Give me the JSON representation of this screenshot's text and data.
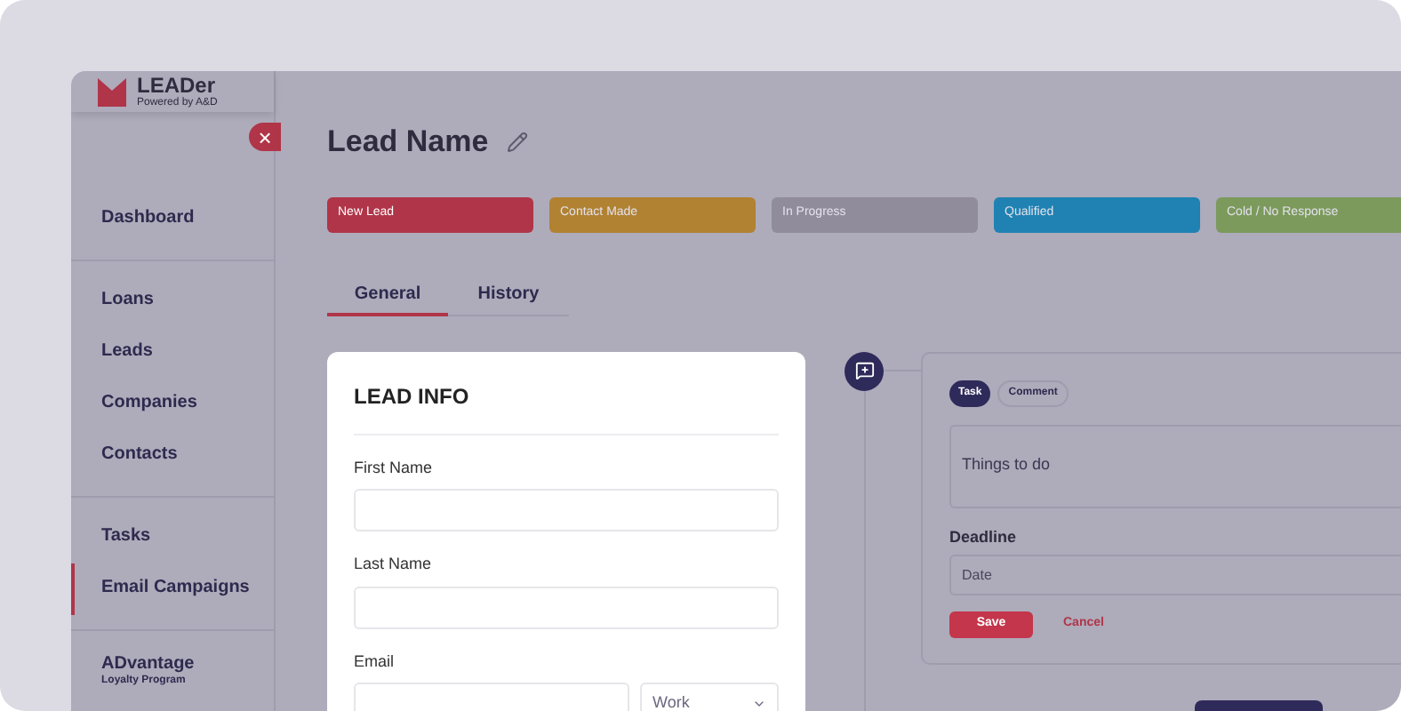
{
  "logo": {
    "name": "LEADer",
    "tagline": "Powered by A&D"
  },
  "sidebar": {
    "sections": [
      [
        {
          "label": "Dashboard",
          "selected": false
        }
      ],
      [
        {
          "label": "Loans",
          "selected": false
        },
        {
          "label": "Leads",
          "selected": false
        },
        {
          "label": "Companies",
          "selected": false
        },
        {
          "label": "Contacts",
          "selected": false
        }
      ],
      [
        {
          "label": "Tasks",
          "selected": false
        },
        {
          "label": "Email Campaigns",
          "selected": true
        }
      ],
      [
        {
          "label": "ADvantage",
          "subtitle": "Loyalty Program",
          "selected": false
        }
      ]
    ]
  },
  "close_button": {
    "symbol": "×"
  },
  "page": {
    "title": "Lead Name"
  },
  "statuses": [
    {
      "label": "New Lead",
      "color": "#b03548",
      "selected": true
    },
    {
      "label": "Contact Made",
      "color": "#b08232",
      "selected": false
    },
    {
      "label": "In Progress",
      "color": "#908c9c",
      "selected": false
    },
    {
      "label": "Qualified",
      "color": "#1f82b2",
      "selected": false
    },
    {
      "label": "Cold / No Response",
      "color": "#7b9a5c",
      "selected": false
    }
  ],
  "tabs": [
    {
      "label": "General",
      "selected": true
    },
    {
      "label": "History",
      "selected": false
    }
  ],
  "lead_info": {
    "title": "LEAD INFO",
    "fields": [
      {
        "label": "First Name",
        "kind": "text"
      },
      {
        "label": "Last Name",
        "kind": "text"
      },
      {
        "label": "Email",
        "kind": "email",
        "type_value": "Work"
      }
    ]
  },
  "activity": {
    "types": [
      {
        "label": "Task",
        "selected": true
      },
      {
        "label": "Comment",
        "selected": false
      }
    ],
    "text": "Things to do",
    "deadline_label": "Deadline",
    "deadline_placeholder": "Date",
    "save": "Save",
    "cancel": "Cancel"
  }
}
